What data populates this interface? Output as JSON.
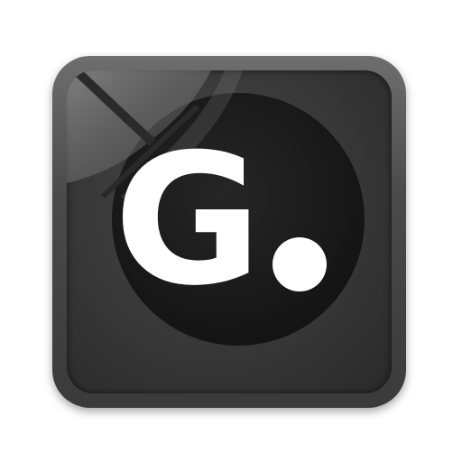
{
  "icon": {
    "name": "g-app-icon",
    "letter": "G",
    "colors": {
      "bezel": "#555555",
      "face": "#3a3a3a",
      "disc": "#1c1c1c",
      "glyph": "#ffffff"
    }
  }
}
